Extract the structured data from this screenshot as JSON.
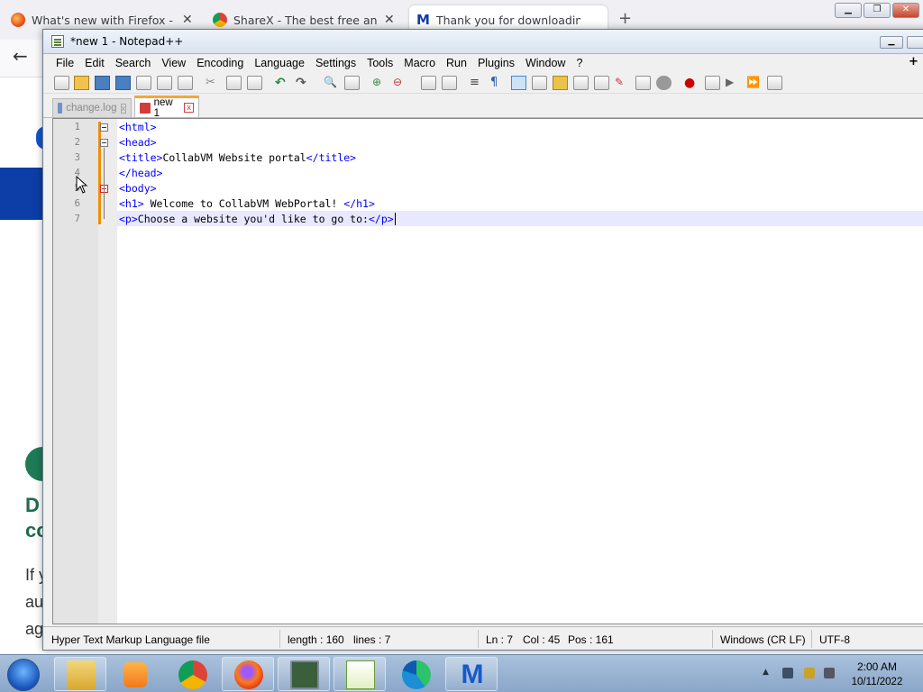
{
  "browser": {
    "tabs": [
      {
        "title": "What's new with Firefox - More"
      },
      {
        "title": "ShareX - The best free and open"
      },
      {
        "title": "Thank you for downloading Ma"
      }
    ]
  },
  "page_behind": {
    "lines": [
      "D",
      "co",
      "If y",
      "au",
      "ag"
    ]
  },
  "npp": {
    "title": "*new 1 - Notepad++",
    "menu": [
      "File",
      "Edit",
      "Search",
      "View",
      "Encoding",
      "Language",
      "Settings",
      "Tools",
      "Macro",
      "Run",
      "Plugins",
      "Window",
      "?"
    ],
    "menu_plus": "+",
    "tabs": [
      {
        "label": "change.log"
      },
      {
        "label": "new 1"
      }
    ],
    "lines": [
      {
        "n": "1",
        "code": [
          {
            "t": "tag",
            "s": "<html>"
          }
        ]
      },
      {
        "n": "2",
        "code": [
          {
            "t": "tag",
            "s": "<head>"
          }
        ]
      },
      {
        "n": "3",
        "code": [
          {
            "t": "tag",
            "s": "<title>"
          },
          {
            "t": "txt",
            "s": "CollabVM Website portal"
          },
          {
            "t": "tag",
            "s": "</title>"
          }
        ]
      },
      {
        "n": "4",
        "code": [
          {
            "t": "tag",
            "s": "</head>"
          }
        ]
      },
      {
        "n": "5",
        "code": [
          {
            "t": "tag",
            "s": "<body>"
          }
        ]
      },
      {
        "n": "6",
        "code": [
          {
            "t": "tag",
            "s": "<h1>"
          },
          {
            "t": "txt",
            "s": " Welcome to CollabVM WebPortal! "
          },
          {
            "t": "tag",
            "s": "</h1>"
          }
        ]
      },
      {
        "n": "7",
        "code": [
          {
            "t": "tag",
            "s": "<p>"
          },
          {
            "t": "txt",
            "s": "Choose a website you'd like to go to:"
          },
          {
            "t": "tag",
            "s": "</p>"
          }
        ]
      }
    ],
    "status": {
      "filetype": "Hyper Text Markup Language file",
      "length": "length : 160",
      "lines": "lines : 7",
      "ln": "Ln : 7",
      "col": "Col : 45",
      "pos": "Pos : 161",
      "eol": "Windows (CR LF)",
      "encoding": "UTF-8"
    }
  },
  "taskbar": {
    "apps": [
      "explorer",
      "media-player",
      "chrome",
      "firefox",
      "task-manager",
      "notepad++",
      "edge",
      "malwarebytes"
    ],
    "time": "2:00 AM",
    "date": "10/11/2022"
  }
}
